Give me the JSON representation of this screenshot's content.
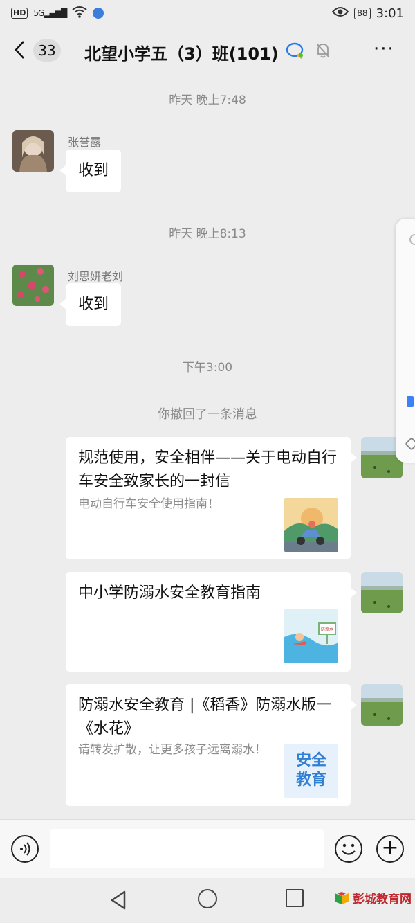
{
  "status_bar": {
    "network_label": "HD",
    "signal_label": "5G",
    "battery": "88",
    "time": "3:01"
  },
  "header": {
    "unread_count": "33",
    "title": "北望小学五（3）班(101)"
  },
  "messages": [
    {
      "type": "timestamp",
      "text": "昨天 晚上7:48"
    },
    {
      "type": "text",
      "sender": "张誉露",
      "text": "收到"
    },
    {
      "type": "timestamp",
      "text": "昨天 晚上8:13"
    },
    {
      "type": "text",
      "sender": "刘思妍老刘",
      "text": "收到"
    },
    {
      "type": "timestamp",
      "text": "下午3:00"
    },
    {
      "type": "system",
      "text": "你撤回了一条消息"
    },
    {
      "type": "card",
      "title": "规范使用，安全相伴——关于电动自行车安全致家长的一封信",
      "desc": "电动自行车安全使用指南！",
      "thumb": "scooter-illustration"
    },
    {
      "type": "card",
      "title": "中小学防溺水安全教育指南",
      "desc": "",
      "thumb": "swimming-illustration"
    },
    {
      "type": "card",
      "title": "防溺水安全教育 |《稻香》防溺水版一《水花》",
      "desc": "请转发扩散，让更多孩子远离溺水！",
      "thumb": "safety-education-badge",
      "thumb_text": "安全教育"
    }
  ],
  "thumb_sign_text": "防溺水",
  "input_bar": {
    "placeholder": ""
  },
  "watermark": "彭城教育网",
  "colors": {
    "background": "#ededed",
    "bubble": "#ffffff",
    "accent_blue": "#3b7ddd",
    "watermark_red": "#c0282e"
  }
}
